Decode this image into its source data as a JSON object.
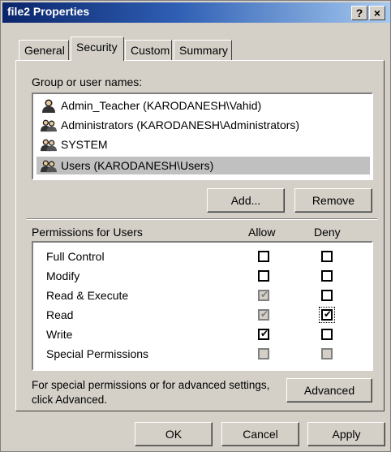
{
  "window": {
    "title": "file2 Properties",
    "help_button": "?",
    "close_button": "×"
  },
  "tabs": [
    {
      "label": "General",
      "active": false
    },
    {
      "label": "Security",
      "active": true
    },
    {
      "label": "Custom",
      "active": false
    },
    {
      "label": "Summary",
      "active": false
    }
  ],
  "groups": {
    "label": "Group or user names:",
    "items": [
      {
        "name": "Admin_Teacher (KARODANESH\\Vahid)",
        "icon": "user-icon",
        "selected": false
      },
      {
        "name": "Administrators (KARODANESH\\Administrators)",
        "icon": "users-group-icon",
        "selected": false
      },
      {
        "name": "SYSTEM",
        "icon": "users-group-icon",
        "selected": false
      },
      {
        "name": "Users (KARODANESH\\Users)",
        "icon": "users-group-icon",
        "selected": true
      }
    ],
    "add_label": "Add...",
    "remove_label": "Remove"
  },
  "permissions": {
    "header": "Permissions for Users",
    "allow_header": "Allow",
    "deny_header": "Deny",
    "rows": [
      {
        "name": "Full Control",
        "allow": {
          "checked": false,
          "disabled": false
        },
        "deny": {
          "checked": false,
          "disabled": false
        }
      },
      {
        "name": "Modify",
        "allow": {
          "checked": false,
          "disabled": false
        },
        "deny": {
          "checked": false,
          "disabled": false
        }
      },
      {
        "name": "Read & Execute",
        "allow": {
          "checked": true,
          "disabled": true
        },
        "deny": {
          "checked": false,
          "disabled": false
        }
      },
      {
        "name": "Read",
        "allow": {
          "checked": true,
          "disabled": true
        },
        "deny": {
          "checked": true,
          "disabled": false,
          "focused": true
        }
      },
      {
        "name": "Write",
        "allow": {
          "checked": true,
          "disabled": false
        },
        "deny": {
          "checked": false,
          "disabled": false
        }
      },
      {
        "name": "Special Permissions",
        "allow": {
          "checked": false,
          "disabled": true
        },
        "deny": {
          "checked": false,
          "disabled": true
        }
      }
    ]
  },
  "advanced": {
    "text_line1": "For special permissions or for advanced settings,",
    "text_line2": "click Advanced.",
    "button_label": "Advanced"
  },
  "footer": {
    "ok_label": "OK",
    "cancel_label": "Cancel",
    "apply_label": "Apply"
  },
  "colors": {
    "face": "#d4d0c8",
    "title_start": "#0a246a",
    "title_end": "#a6caf0",
    "selection": "#c0c0c0"
  }
}
